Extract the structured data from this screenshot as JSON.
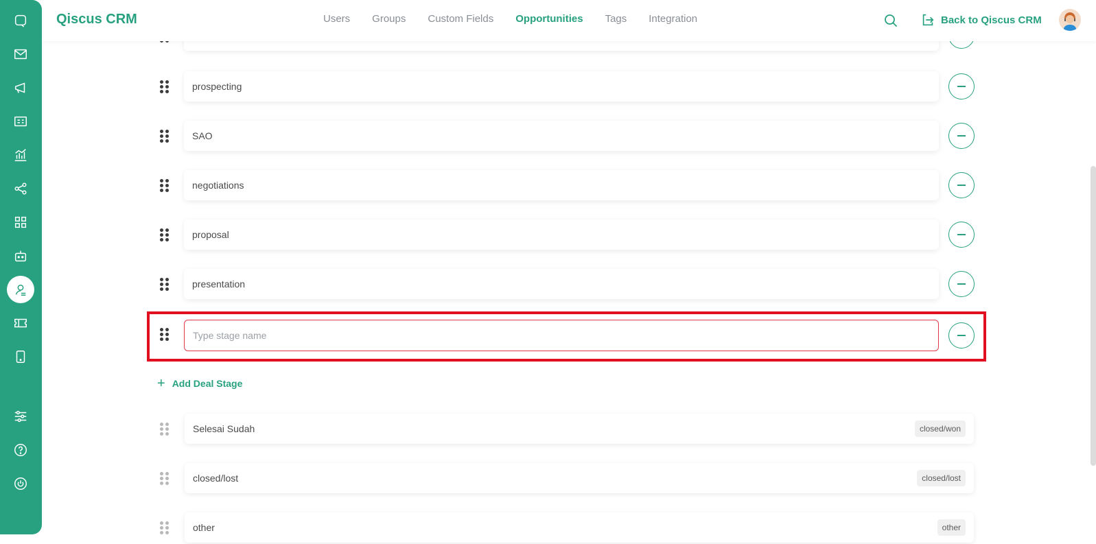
{
  "app": {
    "brand": "Qiscus CRM"
  },
  "nav": {
    "items": [
      "Users",
      "Groups",
      "Custom Fields",
      "Opportunities",
      "Tags",
      "Integration"
    ],
    "active": "Opportunities"
  },
  "header": {
    "back_label": "Back to Qiscus CRM"
  },
  "stages": [
    {
      "name": ""
    },
    {
      "name": "prospecting"
    },
    {
      "name": "SAO"
    },
    {
      "name": "negotiations"
    },
    {
      "name": "proposal"
    },
    {
      "name": "presentation"
    }
  ],
  "new_stage": {
    "value": "",
    "placeholder": "Type stage name"
  },
  "add_stage_label": "Add Deal Stage",
  "fixed_stages": [
    {
      "name": "Selesai Sudah",
      "tag": "closed/won"
    },
    {
      "name": "closed/lost",
      "tag": "closed/lost"
    },
    {
      "name": "other",
      "tag": "other"
    }
  ],
  "colors": {
    "accent": "#27a17f",
    "highlight": "#e01020",
    "error_border": "#e03a4a"
  }
}
